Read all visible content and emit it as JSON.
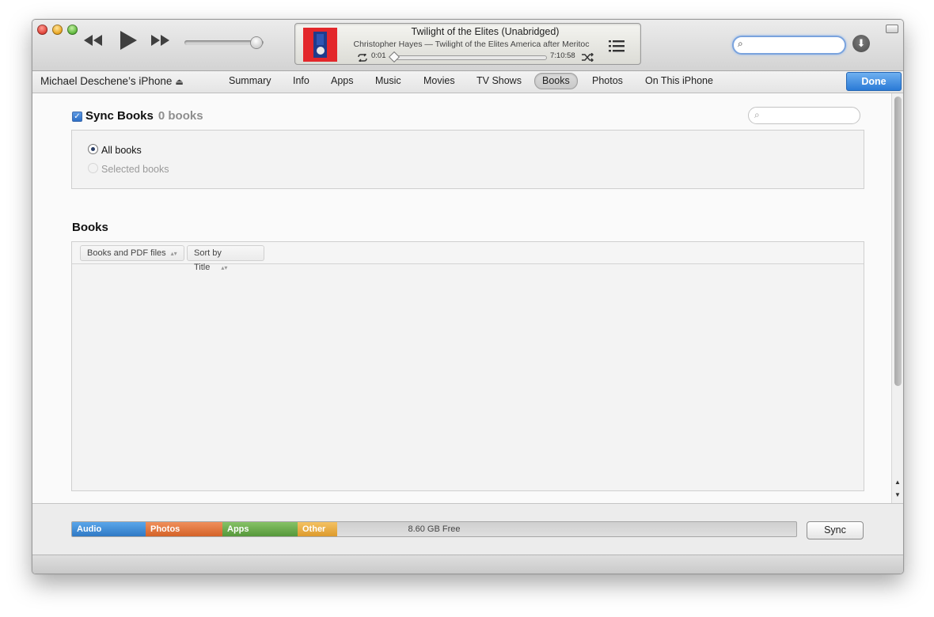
{
  "player": {
    "title": "Twilight of the Elites (Unabridged)",
    "subtitle": "Christopher Hayes — Twilight of the Elites America after Meritoc",
    "elapsed": "0:01",
    "remaining": "7:10:58",
    "progress_fraction": 0.0,
    "volume_fraction": 0.9
  },
  "nav": {
    "device_name": "Michael Deschene’s iPhone",
    "tabs": [
      {
        "label": "Summary"
      },
      {
        "label": "Info"
      },
      {
        "label": "Apps"
      },
      {
        "label": "Music"
      },
      {
        "label": "Movies"
      },
      {
        "label": "TV Shows"
      },
      {
        "label": "Books",
        "active": true
      },
      {
        "label": "Photos"
      },
      {
        "label": "On This iPhone"
      }
    ],
    "done_label": "Done"
  },
  "sync": {
    "title": "Sync Books",
    "count": "0 books",
    "checked": true,
    "options": [
      {
        "label": "All books",
        "selected": true
      },
      {
        "label": "Selected books",
        "selected": false
      }
    ]
  },
  "books": {
    "heading": "Books",
    "filter_label": "Books and PDF files",
    "sort_label": "Sort by Title"
  },
  "capacity": {
    "segments": [
      {
        "label": "Audio",
        "color": "#3d8bd4"
      },
      {
        "label": "Photos",
        "color": "#e0743b"
      },
      {
        "label": "Apps",
        "color": "#67a84a"
      },
      {
        "label": "Other",
        "color": "#e7a940"
      }
    ],
    "free_label": "8.60 GB Free"
  },
  "footer": {
    "sync_label": "Sync"
  }
}
